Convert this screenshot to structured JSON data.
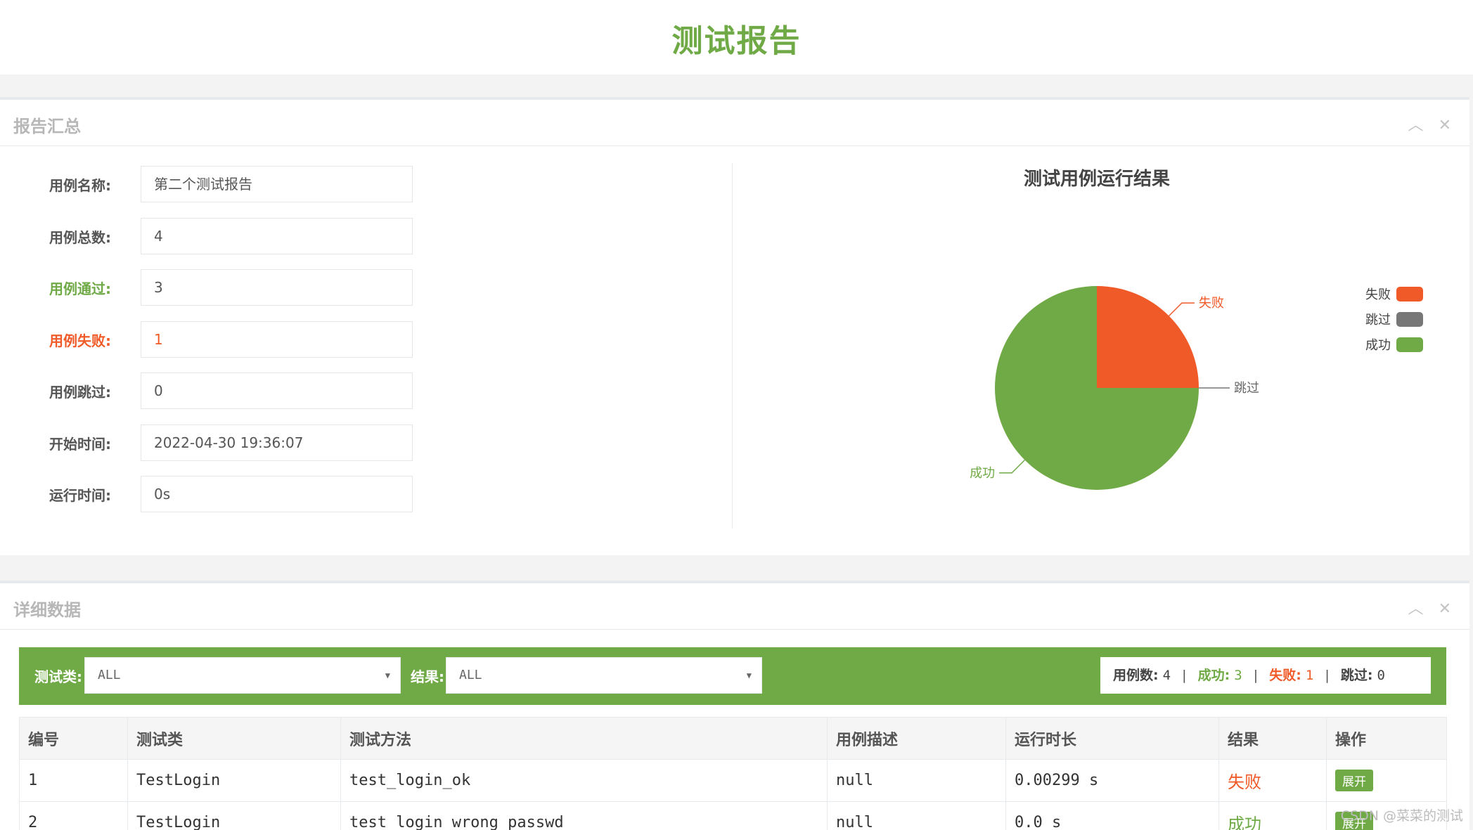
{
  "page": {
    "title": "测试报告"
  },
  "summary": {
    "title": "报告汇总",
    "collapse_icon": "chevron-up-icon",
    "close_icon": "close-icon",
    "fields": [
      {
        "label": "用例名称:",
        "value": "第二个测试报告"
      },
      {
        "label": "用例总数:",
        "value": "4"
      },
      {
        "label": "用例通过:",
        "value": "3"
      },
      {
        "label": "用例失败:",
        "value": "1"
      },
      {
        "label": "用例跳过:",
        "value": "0"
      },
      {
        "label": "开始时间:",
        "value": "2022-04-30 19:36:07"
      },
      {
        "label": "运行时间:",
        "value": "0s"
      }
    ]
  },
  "chart_data": {
    "type": "pie",
    "title": "测试用例运行结果",
    "series": [
      {
        "name": "失败",
        "value": 1,
        "color": "#f05a28"
      },
      {
        "name": "跳过",
        "value": 0,
        "color": "#777777"
      },
      {
        "name": "成功",
        "value": 3,
        "color": "#6faa46"
      }
    ],
    "legend": "right"
  },
  "detail": {
    "title": "详细数据",
    "filter": {
      "class_label": "测试类:",
      "class_value": "ALL",
      "result_label": "结果:",
      "result_value": "ALL"
    },
    "stats": {
      "total_label": "用例数:",
      "total": "4",
      "pass_label": "成功:",
      "pass": "3",
      "fail_label": "失败:",
      "fail": "1",
      "skip_label": "跳过:",
      "skip": "0",
      "sep": "|"
    },
    "columns": [
      "编号",
      "测试类",
      "测试方法",
      "用例描述",
      "运行时长",
      "结果",
      "操作"
    ],
    "rows": [
      {
        "id": "1",
        "cls": "TestLogin",
        "method": "test_login_ok",
        "desc": "null",
        "duration": "0.00299 s",
        "result": "失败",
        "action": "展开"
      },
      {
        "id": "2",
        "cls": "TestLogin",
        "method": "test_login_wrong_passwd",
        "desc": "null",
        "duration": "0.0 s",
        "result": "成功",
        "action": "展开"
      }
    ]
  },
  "watermark": "CSDN @菜菜的测试"
}
